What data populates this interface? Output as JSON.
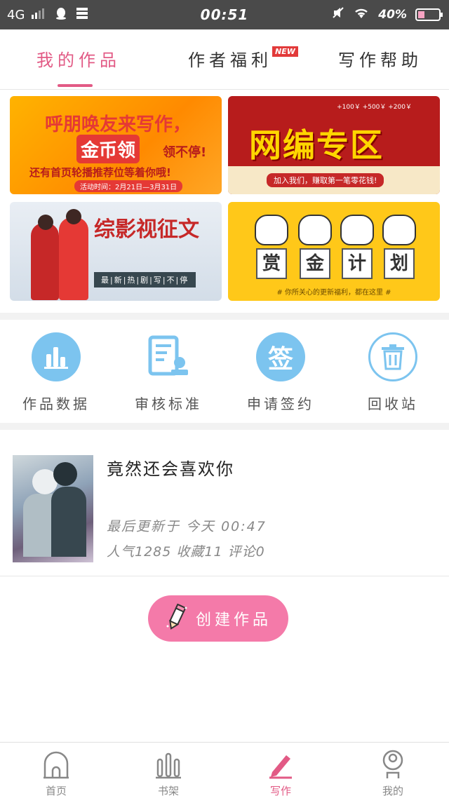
{
  "status_bar": {
    "network": "4G",
    "time": "00:51",
    "battery": "40%",
    "battery_level": 0.4
  },
  "top_tabs": [
    {
      "label": "我的作品",
      "active": true
    },
    {
      "label": "作者福利",
      "badge": "NEW"
    },
    {
      "label": "写作帮助"
    }
  ],
  "banners": {
    "b1": {
      "line1": "呼朋唤友来写作，",
      "line2": "金币领",
      "line2_suffix": "领不停!",
      "line3": "还有首页轮播推荐位等着你哦!",
      "line4": "活动时间：2月21日—3月31日"
    },
    "b2": {
      "bonus": "+100￥  +500￥  +200￥",
      "title": "网编专区",
      "slogan": "加入我们，赚取第一笔零花钱!"
    },
    "b3": {
      "title": "综影视征文",
      "subtitle": "最|新|热|剧|写|不|停"
    },
    "b4": {
      "chars": [
        "赏",
        "金",
        "计",
        "划"
      ],
      "footer": "# 你所关心的更新福利，都在这里 #"
    }
  },
  "tools": [
    {
      "label": "作品数据",
      "icon": "bar-chart-icon"
    },
    {
      "label": "审核标准",
      "icon": "document-stamp-icon"
    },
    {
      "label": "申请签约",
      "icon": "sign-icon",
      "icon_text": "签"
    },
    {
      "label": "回收站",
      "icon": "trash-icon"
    }
  ],
  "work": {
    "title": "竟然还会喜欢你",
    "updated": "最后更新于  今天  00:47",
    "stats": "人气1285 收藏11 评论0"
  },
  "create_button": {
    "label": "创建作品"
  },
  "bottom_nav": [
    {
      "label": "首页",
      "icon": "home-icon"
    },
    {
      "label": "书架",
      "icon": "bookshelf-icon"
    },
    {
      "label": "写作",
      "icon": "pen-icon",
      "active": true
    },
    {
      "label": "我的",
      "icon": "profile-icon"
    }
  ],
  "colors": {
    "accent": "#e25a85",
    "button": "#f47aa9",
    "tool_blue": "#7cc4ef"
  }
}
